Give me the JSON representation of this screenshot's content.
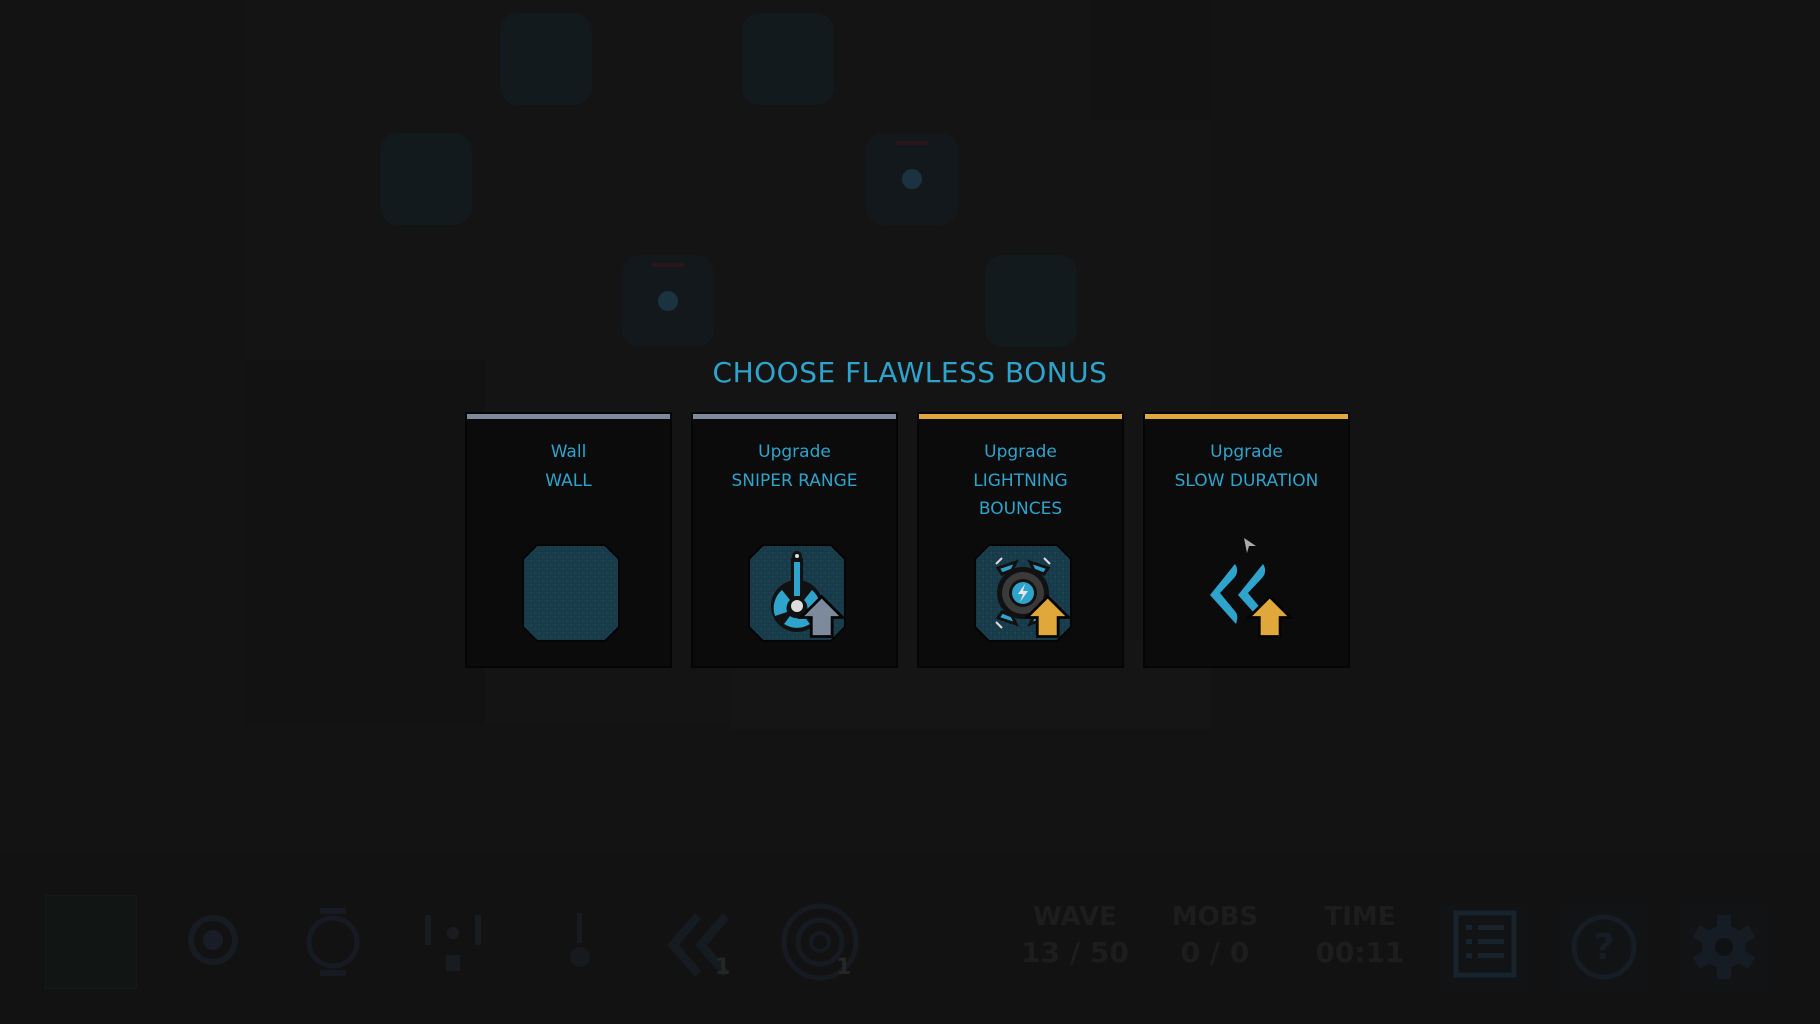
{
  "overlay": {
    "title": "CHOOSE FLAWLESS BONUS",
    "cards": [
      {
        "line1": "Wall",
        "line2": "WALL",
        "line3": "",
        "icon": "wall-tile-icon",
        "accent": "#7d8a9c",
        "upgrade_arrow": false
      },
      {
        "line1": "Upgrade",
        "line2": "SNIPER RANGE",
        "line3": "",
        "icon": "sniper-tower-icon",
        "accent": "#7d8a9c",
        "upgrade_arrow": true,
        "arrow_color": "#7d8a9c"
      },
      {
        "line1": "Upgrade",
        "line2": "LIGHTNING",
        "line3": "BOUNCES",
        "icon": "lightning-tower-icon",
        "accent": "#e0a83a",
        "upgrade_arrow": true,
        "arrow_color": "#e0a83a"
      },
      {
        "line1": "Upgrade",
        "line2": "SLOW DURATION",
        "line3": "",
        "icon": "slow-chevrons-icon",
        "accent": "#e0a83a",
        "upgrade_arrow": true,
        "arrow_color": "#e0a83a"
      }
    ]
  },
  "hud": {
    "towers": [
      {
        "name": "wall-slot"
      },
      {
        "name": "lightning-tower"
      },
      {
        "name": "cannon-tower"
      },
      {
        "name": "laser-tower"
      },
      {
        "name": "sniper-tower"
      },
      {
        "name": "slow-tower",
        "count": "1"
      },
      {
        "name": "target-tower",
        "count": "1"
      }
    ],
    "stats": {
      "wave_label": "WAVE",
      "wave_value": "13 / 50",
      "mobs_label": "MOBS",
      "mobs_value": "0 / 0",
      "time_label": "TIME",
      "time_value": "00:11"
    },
    "buttons": [
      "list-icon",
      "help-icon",
      "settings-icon"
    ]
  },
  "colors": {
    "title": "#2ea3cc",
    "grey_accent": "#7d8a9c",
    "gold_accent": "#e0a83a",
    "tower_blue": "#2ea3cc"
  }
}
